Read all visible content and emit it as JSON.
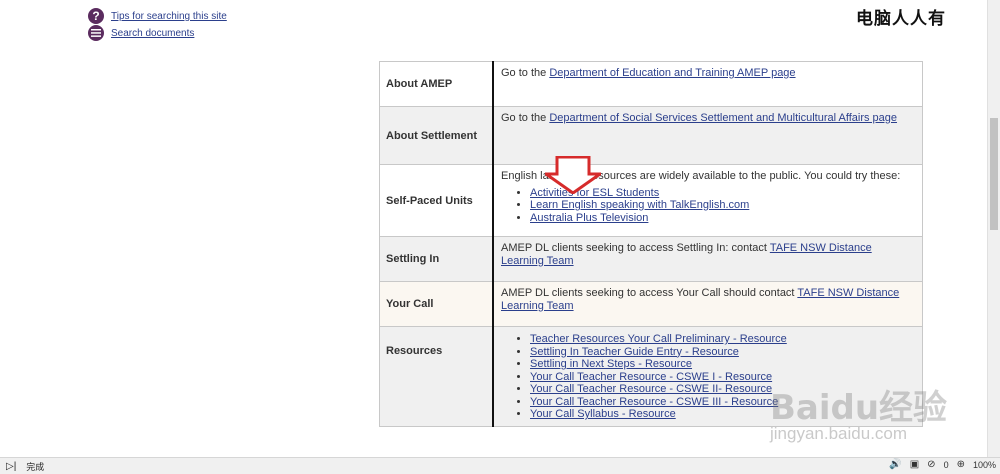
{
  "help": {
    "tips_label": "Tips for searching this site",
    "search_docs_label": "Search documents"
  },
  "watermark": {
    "top_text": "电脑人人有",
    "baidu_text": "Baidu经验",
    "baidu_url": "jingyan.baidu.com"
  },
  "table": {
    "about_amep": {
      "header": "About AMEP",
      "prefix": "Go to the ",
      "link": "Department of Education and Training AMEP page"
    },
    "about_settlement": {
      "header": "About Settlement",
      "prefix": "Go to the ",
      "link": "Department of Social Services Settlement and Multicultural Affairs page"
    },
    "self_paced": {
      "header": "Self-Paced Units",
      "text": "English language resources are widely available to the public.  You could try these:",
      "links": [
        "Activities for ESL Students",
        "Learn English speaking with TalkEnglish.com",
        "Australia Plus Television"
      ]
    },
    "settling_in": {
      "header": "Settling In",
      "prefix": "AMEP DL clients seeking to access Settling In: contact ",
      "link": "TAFE NSW Distance Learning Team"
    },
    "your_call": {
      "header": "Your Call",
      "prefix": "AMEP DL clients seeking to access Your Call should contact ",
      "link": "TAFE NSW Distance Learning Team"
    },
    "resources": {
      "header": "Resources",
      "links": [
        "Teacher Resources Your Call Preliminary - Resource",
        "Settling In Teacher Guide Entry - Resource",
        "Settling in Next Steps - Resource",
        "Your Call Teacher Resource - CSWE I - Resource",
        "Your Call Teacher Resource - CSWE II- Resource",
        "Your Call Teacher Resource - CSWE III - Resource",
        "Your Call Syllabus - Resource"
      ]
    }
  },
  "status": {
    "text": "完成",
    "count": "0",
    "zoom": "100%"
  },
  "colors": {
    "link": "#2b3f8c",
    "help_icon": "#5b2c5f",
    "arrow": "#d62b2b"
  }
}
